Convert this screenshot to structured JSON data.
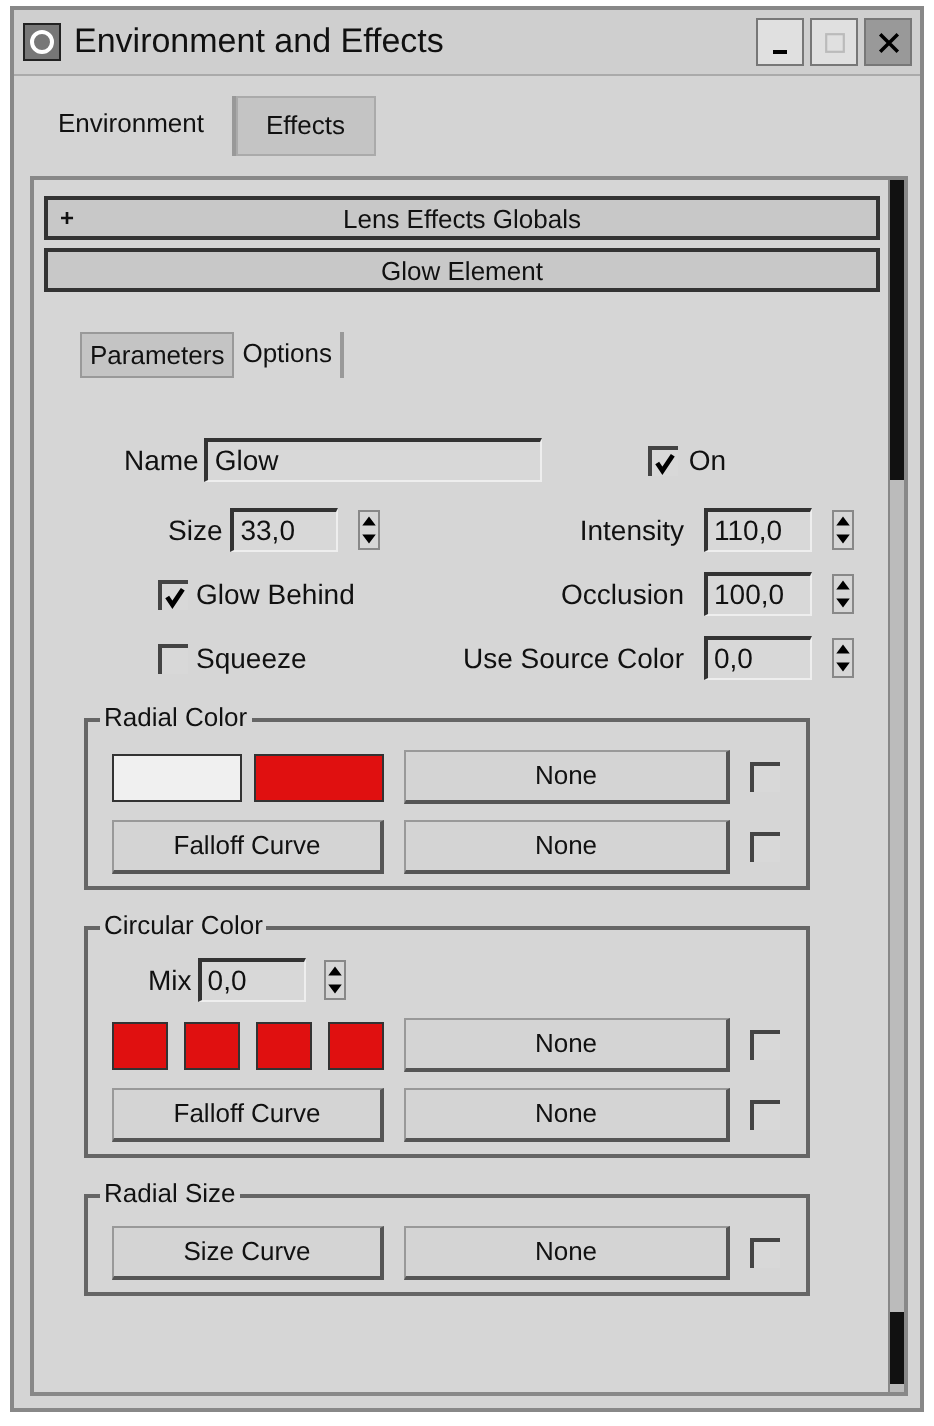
{
  "window": {
    "title": "Environment and Effects"
  },
  "tabs": [
    {
      "label": "Environment",
      "selected": false
    },
    {
      "label": "Effects",
      "selected": true
    }
  ],
  "rollouts": [
    {
      "toggle": "+",
      "title": "Lens Effects Globals"
    },
    {
      "title": "Glow Element"
    }
  ],
  "subtabs": [
    {
      "label": "Parameters",
      "selected": true
    },
    {
      "label": "Options",
      "selected": false
    }
  ],
  "name": {
    "label": "Name",
    "value": "Glow"
  },
  "on": {
    "label": "On",
    "checked": true
  },
  "left_fields": [
    {
      "kind": "spinner",
      "label": "Size",
      "value": "33,0"
    },
    {
      "kind": "checkbox",
      "label": "Glow Behind",
      "checked": true
    },
    {
      "kind": "checkbox",
      "label": "Squeeze",
      "checked": false
    }
  ],
  "right_fields": [
    {
      "kind": "spinner",
      "label": "Intensity",
      "value": "110,0"
    },
    {
      "kind": "spinner",
      "label": "Occlusion",
      "value": "100,0"
    },
    {
      "kind": "spinner",
      "label": "Use Source Color",
      "value": "0,0"
    }
  ],
  "groups": [
    {
      "title": "Radial Color",
      "rows": [
        {
          "kind": "swatches",
          "swatches": [
            {
              "color": "#f0f0f0"
            },
            {
              "color": "#e01010"
            }
          ],
          "map": "None",
          "checked": false
        },
        {
          "kind": "curve",
          "button": "Falloff Curve",
          "map": "None",
          "checked": false
        }
      ]
    },
    {
      "title": "Circular Color",
      "rows": [
        {
          "kind": "spinner",
          "label": "Mix",
          "value": "0,0"
        },
        {
          "kind": "swatches",
          "swatches": [
            {
              "color": "#e01010"
            },
            {
              "color": "#e01010"
            },
            {
              "color": "#e01010"
            },
            {
              "color": "#e01010"
            }
          ],
          "map": "None",
          "checked": false
        },
        {
          "kind": "curve",
          "button": "Falloff Curve",
          "map": "None",
          "checked": false
        }
      ]
    },
    {
      "title": "Radial Size",
      "rows": [
        {
          "kind": "curve",
          "button": "Size Curve",
          "map": "None",
          "checked": false
        }
      ]
    }
  ]
}
